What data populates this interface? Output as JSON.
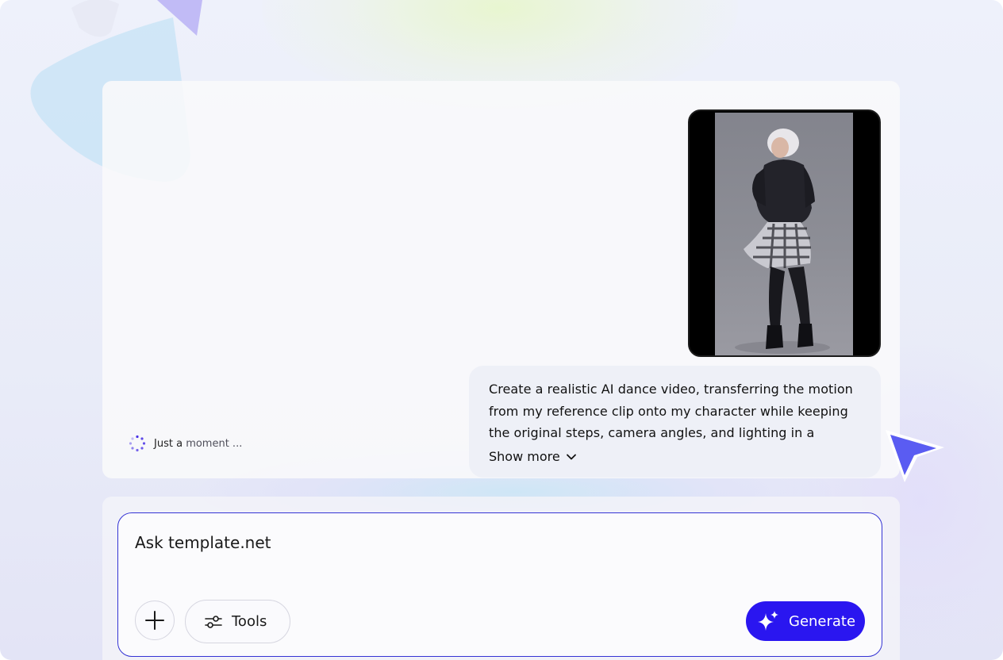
{
  "status": {
    "text_strong": "Just a",
    "text_soft": "moment ..."
  },
  "message": {
    "text": "Create a realistic AI dance video, transferring the motion from my reference clip onto my character while keeping the original steps, camera angles, and lighting in a vibrant...",
    "show_more_label": "Show more"
  },
  "composer": {
    "placeholder": "Ask template.net",
    "tools_label": "Tools",
    "generate_label": "Generate"
  },
  "colors": {
    "accent": "#2a16f0",
    "composer_border": "#3534d4",
    "cursor": "#5a5cf2",
    "spinner": "#4a33e6"
  },
  "icons": {
    "add": "plus-icon",
    "tools": "sliders-icon",
    "generate": "sparkle-icon",
    "show_more": "chevron-down-icon",
    "status": "spinner-icon",
    "cursor": "pointer-arrow-icon"
  }
}
